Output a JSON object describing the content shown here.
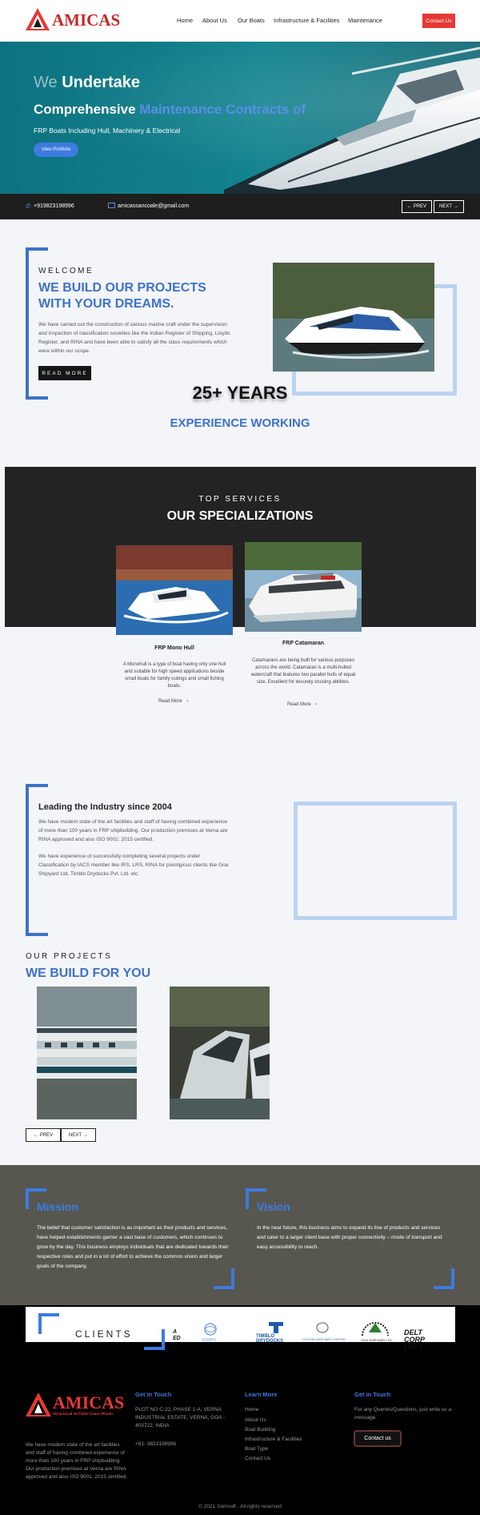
{
  "header": {
    "logo_text": "AMICAS",
    "nav": [
      "Home",
      "About Us",
      "Our Boats",
      "Infrastructure & Facilities",
      "Maintenance"
    ],
    "contact_button": "Contact Us"
  },
  "hero": {
    "line1_dim": "We",
    "line1_main": "Undertake",
    "line2_main": "Comprehensive",
    "line2_highlight": "Maintenance Contracts of",
    "subtitle": "FRP Boats Including Hull, Machinery & Electrical",
    "button": "View Portfolio"
  },
  "contact_bar": {
    "phone": "+919823198996",
    "email": "amicassancoale@gmail.com",
    "prev": "PREV",
    "next": "NEXT"
  },
  "welcome": {
    "label": "WELCOME",
    "title": "WE BUILD OUR PROJECTS WITH YOUR DREAMS.",
    "body": "We have carried out the construction of various marine craft under the supervision and inspection of classification societies like the Indian Register of Shipping, Lloyds Register, and RINA and have been able to satisfy all the class requirements which were within our scope.",
    "button": "READ MORE",
    "years": "25+ YEARS",
    "years_sub": "EXPERIENCE WORKING"
  },
  "services": {
    "label": "TOP SERVICES",
    "title": "OUR SPECIALIZATIONS",
    "cards": [
      {
        "title": "FRP Mono Hull",
        "body": "A Monohull is a type of boat having only one hull and suitable for high speed applications beside small boats for family outings and small fishing boats.",
        "more": "Read More"
      },
      {
        "title": "FRP Catamaran",
        "body": "Catamarans are being built for various purposes across the world. Catamaran is a multi-hulled watercraft that features two parallel hulls of equal size. Excellent for leisurely cruising abilities.",
        "more": "Read More"
      }
    ]
  },
  "leading": {
    "title": "Leading the Industry since 2004",
    "para1": "We have modern state of the art facilities and staff of having combined experience of more than 100 years in FRP shipbuilding. Our production premises at Verna are RINA approved and also ISO 9001: 2015 certified.",
    "para2": "We have experience of successfully completing several projects under Classification by IACS member like IRS, LRS, RINA for prestigious clients like Goa Shipyard Ltd, Timblo Drydocks Pvt. Ltd. etc."
  },
  "projects": {
    "label": "OUR PROJECTS",
    "title": "WE BUILD FOR YOU",
    "prev": "PREV",
    "next": "NEXT"
  },
  "mission": {
    "title": "Mission",
    "body": "The belief that customer satisfaction is as important as their products and services, have helped establishments garner a vast base of customers, which continues to grow by the day. This business employs individuals that are dedicated towards their respective roles and put in a lot of effort to achieve the common vision and larger goals of the company."
  },
  "vision": {
    "title": "Vision",
    "body": "In the near future, this business aims to expand its line of products and services and cater to a larger client base with proper connectivity – mode of transport and easy accessibility to reach."
  },
  "clients": {
    "label": "CLIENTS",
    "logos": [
      "A ED",
      "SEMPO",
      "TIMBLO DRYDOCKS",
      "COCHIN SHIPYARD LIMITED",
      "GOA SHIPYARD LTD.",
      "DELT CORP LIMIT"
    ]
  },
  "footer": {
    "logo_text": "AMICAS",
    "logo_tagline": "Structural & Fiber Glass Works",
    "about": "We have modern state of the art facilities and staff of having combined experience of more than 100 years in FRP shipbuilding. Our production premises at Verna are RINA approved and also ISO 9001: 2015 certified.",
    "get_in_touch_title": "Get in Touch",
    "address": "PLOT NO C-22, PHASE 1-A, VERNA INDUSTRIAL ESTATE, VERNA, GOA - 403722, INDIA",
    "phone": "+91- 9823198996",
    "learn_more_title": "Learn More",
    "links": [
      "Home",
      "About Us",
      "Boat Building",
      "Infrastructure & Facilities",
      "Boat Type",
      "Contact Us"
    ],
    "get_in_touch_title2": "Get in Touch",
    "queries": "For any Queries/Questions, just write us a message.",
    "contact_button": "Contact us",
    "copyright": "© 2021 Xamsoft . All rights reserved"
  }
}
